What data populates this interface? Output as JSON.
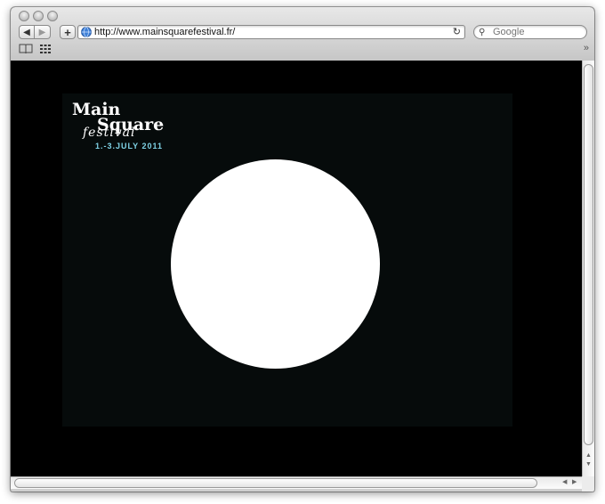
{
  "browser": {
    "url": "http://www.mainsquarefestival.fr/",
    "search_placeholder": "Google",
    "overflow_label": "»"
  },
  "logo": {
    "main": "Main",
    "square": "Square",
    "festival": "festival",
    "dates": "1.-3.JULY 2011"
  },
  "colors": {
    "accent_dates": "#7fd3e6",
    "stage_background": "#060b0b"
  }
}
